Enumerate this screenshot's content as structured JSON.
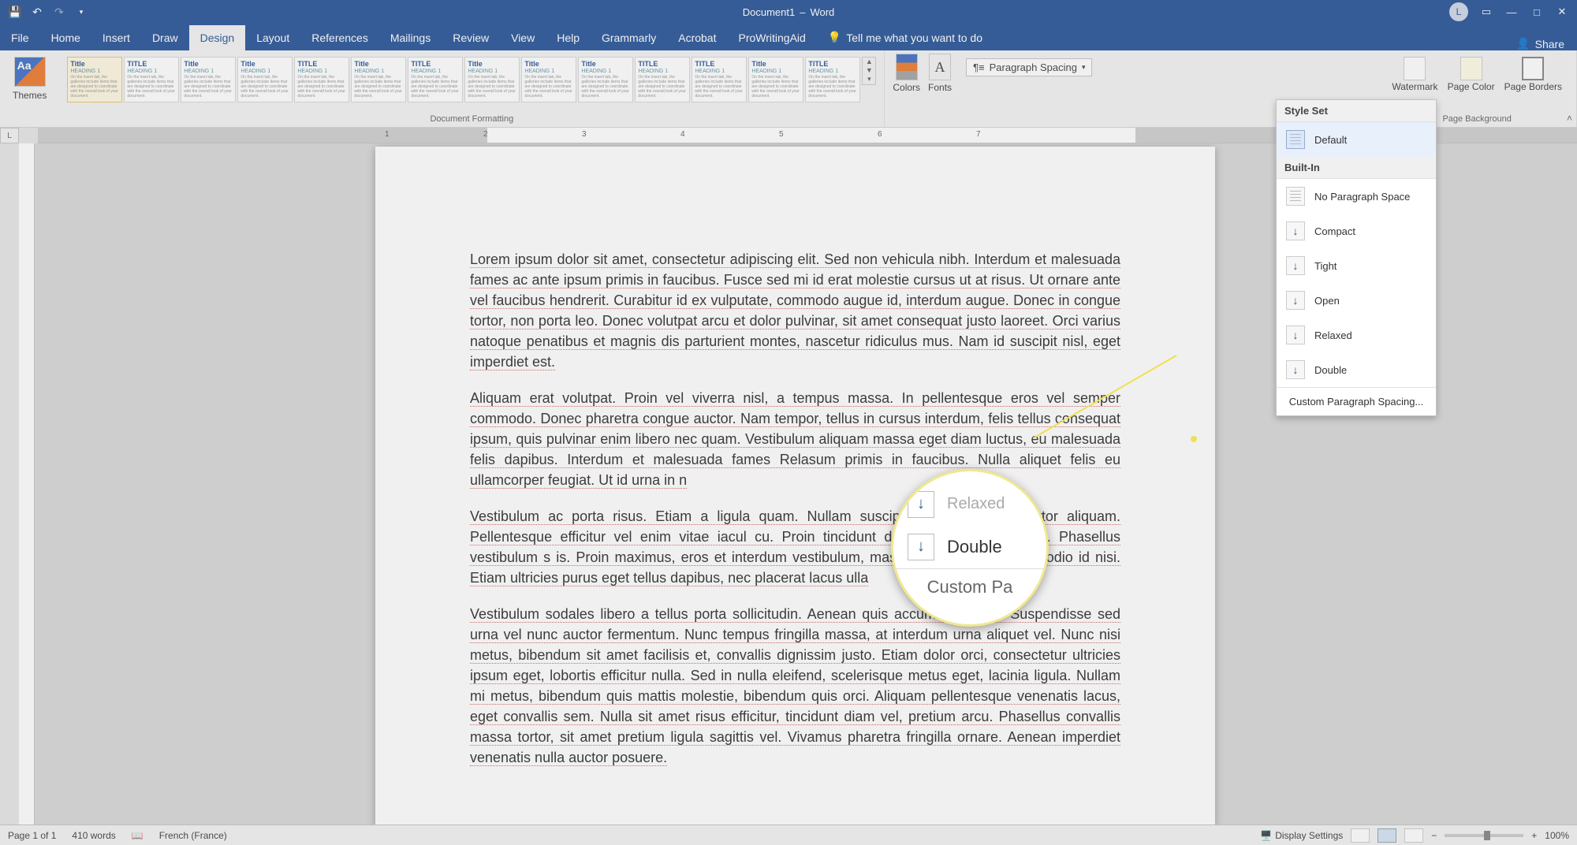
{
  "titlebar": {
    "doc_name": "Document1",
    "app_name": "Word",
    "avatar_initial": "L"
  },
  "tabs": {
    "file": "File",
    "home": "Home",
    "insert": "Insert",
    "draw": "Draw",
    "design": "Design",
    "layout": "Layout",
    "references": "References",
    "mailings": "Mailings",
    "review": "Review",
    "view": "View",
    "help": "Help",
    "grammarly": "Grammarly",
    "acrobat": "Acrobat",
    "prowritingaid": "ProWritingAid",
    "tellme": "Tell me what you want to do",
    "share": "Share"
  },
  "ribbon": {
    "themes": "Themes",
    "doc_formatting_label": "Document Formatting",
    "colors": "Colors",
    "fonts": "Fonts",
    "para_spacing_btn": "Paragraph Spacing",
    "watermark": "Watermark",
    "page_color": "Page Color",
    "page_borders": "Page Borders",
    "page_bg_label": "Page Background",
    "gallery_titles": [
      "Title",
      "TITLE",
      "Title",
      "Title",
      "TITLE",
      "Title",
      "TITLE",
      "Title",
      "Title",
      "Title",
      "TITLE",
      "TITLE",
      "Title",
      "TITLE"
    ]
  },
  "dropdown": {
    "style_set": "Style Set",
    "default": "Default",
    "built_in": "Built-In",
    "no_space": "No Paragraph Space",
    "compact": "Compact",
    "tight": "Tight",
    "open": "Open",
    "relaxed": "Relaxed",
    "double": "Double",
    "custom": "Custom Paragraph Spacing..."
  },
  "magnifier": {
    "relaxed_partial": "Relaxed",
    "double": "Double",
    "custom_partial": "Custom Pa"
  },
  "document": {
    "p1": "Lorem ipsum dolor sit amet, consectetur adipiscing elit. Sed non vehicula nibh. Interdum et malesuada fames ac ante ipsum primis in faucibus. Fusce sed mi id erat molestie cursus ut at risus. Ut ornare ante vel faucibus hendrerit. Curabitur id ex vulputate, commodo augue id, interdum augue. Donec in congue tortor, non porta leo. Donec volutpat arcu et dolor pulvinar, sit amet consequat justo laoreet. Orci varius natoque penatibus et magnis dis parturient montes, nascetur ridiculus mus. Nam id suscipit nisl, eget imperdiet est.",
    "p2": "Aliquam erat volutpat. Proin vel viverra nisl, a tempus massa. In pellentesque eros vel semper commodo. Donec pharetra congue auctor. Nam tempor, tellus in cursus interdum, felis tellus consequat ipsum, quis pulvinar enim libero nec quam. Vestibulum aliquam massa eget diam luctus, eu malesuada felis dapibus. Interdum et malesuada fames Relasum primis in faucibus. Nulla aliquet felis eu ullamcorper feugiat. Ut id urna in n",
    "p3": "Vestibulum ac porta risus. Etiam a ligula quam. Nullam suscipi da, vitae luctus tortor aliquam. Pellentesque efficitur vel enim vitae iacul cu. Proin tincidunt dignissim nunc et mollis. Phasellus vestibulum s is. Proin maximus, eros et interdum vestibulum, massa orci tincidunt jus or odio id nisi. Etiam ultricies purus eget tellus dapibus, nec placerat lacus ulla",
    "p4": "Vestibulum sodales libero a tellus porta sollicitudin. Aenean quis accumsan quam. Suspendisse sed urna vel nunc auctor fermentum. Nunc tempus fringilla massa, at interdum urna aliquet vel. Nunc nisi metus, bibendum sit amet facilisis et, convallis dignissim justo. Etiam dolor orci, consectetur ultricies ipsum eget, lobortis efficitur nulla. Sed in nulla eleifend, scelerisque metus eget, lacinia ligula. Nullam mi metus, bibendum quis mattis molestie, bibendum quis orci. Aliquam pellentesque venenatis lacus, eget convallis sem. Nulla sit amet risus efficitur, tincidunt diam vel, pretium arcu. Phasellus convallis massa tortor, sit amet pretium ligula sagittis vel. Vivamus pharetra fringilla ornare. Aenean imperdiet venenatis nulla auctor posuere."
  },
  "statusbar": {
    "page": "Page 1 of 1",
    "words": "410 words",
    "lang": "French (France)",
    "display_settings": "Display Settings",
    "zoom": "100%"
  },
  "ruler_numbers": [
    "1",
    "2",
    "3",
    "4",
    "5",
    "6",
    "7"
  ]
}
